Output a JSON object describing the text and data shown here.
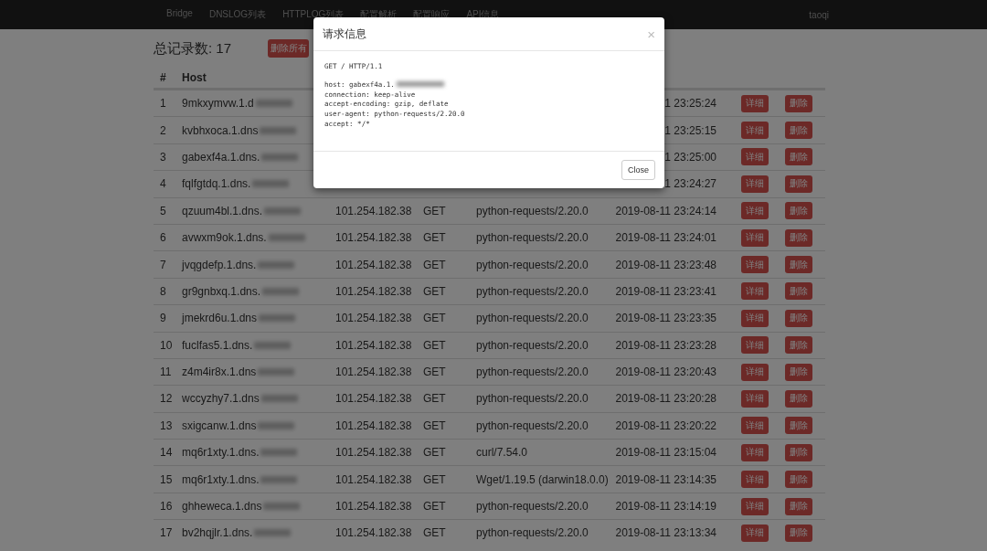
{
  "navbar": {
    "links": [
      {
        "label": "Bridge"
      },
      {
        "label": "DNSLOG列表"
      },
      {
        "label": "HTTPLOG列表"
      },
      {
        "label": "配置解析"
      },
      {
        "label": "配置响应"
      },
      {
        "label": "API信息"
      }
    ],
    "user": "taoqi"
  },
  "summary": {
    "title": "总记录数: 17",
    "delete_all": "删除所有"
  },
  "table": {
    "columns": [
      "#",
      "Host"
    ],
    "rows": [
      {
        "index": "1",
        "host": "9mkxymvw.1.d",
        "date": "1 23:25:24",
        "detail": "详细",
        "delete": "删除"
      },
      {
        "index": "2",
        "host": "kvbhxoca.1.dns",
        "date": "1 23:25:15",
        "detail": "详细",
        "delete": "删除"
      },
      {
        "index": "3",
        "host": "gabexf4a.1.dns.",
        "date": "1 23:25:00",
        "detail": "详细",
        "delete": "删除"
      },
      {
        "index": "4",
        "host": "fqlfgtdq.1.dns.",
        "date": "1 23:24:27",
        "detail": "详细",
        "delete": "删除"
      },
      {
        "index": "5",
        "host": "qzuum4bl.1.dns.",
        "ip": "101.254.182.38",
        "method": "GET",
        "user_agent": "python-requests/2.20.0",
        "date": "2019-08-11 23:24:14",
        "detail": "详细",
        "delete": "删除"
      },
      {
        "index": "6",
        "host": "avwxm9ok.1.dns.",
        "ip": "101.254.182.38",
        "method": "GET",
        "user_agent": "python-requests/2.20.0",
        "date": "2019-08-11 23:24:01",
        "detail": "详细",
        "delete": "删除"
      },
      {
        "index": "7",
        "host": "jvqgdefp.1.dns.",
        "ip": "101.254.182.38",
        "method": "GET",
        "user_agent": "python-requests/2.20.0",
        "date": "2019-08-11 23:23:48",
        "detail": "详细",
        "delete": "删除"
      },
      {
        "index": "8",
        "host": "gr9gnbxq.1.dns.",
        "ip": "101.254.182.38",
        "method": "GET",
        "user_agent": "python-requests/2.20.0",
        "date": "2019-08-11 23:23:41",
        "detail": "详细",
        "delete": "删除"
      },
      {
        "index": "9",
        "host": "jmekrd6u.1.dns",
        "ip": "101.254.182.38",
        "method": "GET",
        "user_agent": "python-requests/2.20.0",
        "date": "2019-08-11 23:23:35",
        "detail": "详细",
        "delete": "删除"
      },
      {
        "index": "10",
        "host": "fuclfas5.1.dns.",
        "ip": "101.254.182.38",
        "method": "GET",
        "user_agent": "python-requests/2.20.0",
        "date": "2019-08-11 23:23:28",
        "detail": "详细",
        "delete": "删除"
      },
      {
        "index": "11",
        "host": "z4m4ir8x.1.dns",
        "ip": "101.254.182.38",
        "method": "GET",
        "user_agent": "python-requests/2.20.0",
        "date": "2019-08-11 23:20:43",
        "detail": "详细",
        "delete": "删除"
      },
      {
        "index": "12",
        "host": "wccyzhy7.1.dns",
        "ip": "101.254.182.38",
        "method": "GET",
        "user_agent": "python-requests/2.20.0",
        "date": "2019-08-11 23:20:28",
        "detail": "详细",
        "delete": "删除"
      },
      {
        "index": "13",
        "host": "sxigcanw.1.dns",
        "ip": "101.254.182.38",
        "method": "GET",
        "user_agent": "python-requests/2.20.0",
        "date": "2019-08-11 23:20:22",
        "detail": "详细",
        "delete": "删除"
      },
      {
        "index": "14",
        "host": "mq6r1xty.1.dns.",
        "ip": "101.254.182.38",
        "method": "GET",
        "user_agent": "curl/7.54.0",
        "date": "2019-08-11 23:15:04",
        "detail": "详细",
        "delete": "删除"
      },
      {
        "index": "15",
        "host": "mq6r1xty.1.dns.",
        "ip": "101.254.182.38",
        "method": "GET",
        "user_agent": "Wget/1.19.5 (darwin18.0.0)",
        "date": "2019-08-11 23:14:35",
        "detail": "详细",
        "delete": "删除"
      },
      {
        "index": "16",
        "host": "ghheweca.1.dns",
        "ip": "101.254.182.38",
        "method": "GET",
        "user_agent": "python-requests/2.20.0",
        "date": "2019-08-11 23:14:19",
        "detail": "详细",
        "delete": "删除"
      },
      {
        "index": "17",
        "host": "bv2hqjlr.1.dns.",
        "ip": "101.254.182.38",
        "method": "GET",
        "user_agent": "python-requests/2.20.0",
        "date": "2019-08-11 23:13:34",
        "detail": "详细",
        "delete": "删除"
      }
    ]
  },
  "modal": {
    "title": "请求信息",
    "close_icon": "×",
    "request_line": "GET / HTTP/1.1",
    "headers": [
      "host: gabexf4a.1.",
      "connection: keep-alive",
      "accept-encoding: gzip, deflate",
      "user-agent: python-requests/2.20.0",
      "accept: */*"
    ],
    "close_button": "Close"
  }
}
